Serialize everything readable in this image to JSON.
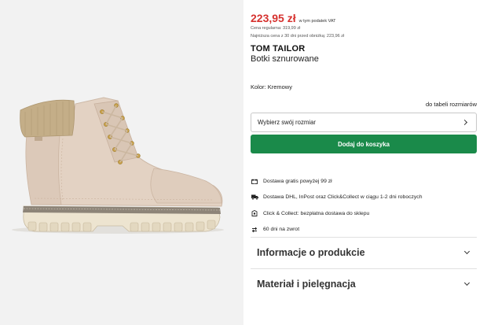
{
  "product": {
    "price": "223,95 zł",
    "vat_note": "w tym podatek VAT",
    "regular_price": "Cena regularna: 319,99 zł",
    "lowest_price": "Najniższa cena z 30 dni przed obniżką: 223,96 zł",
    "brand": "TOM TAILOR",
    "name": "Botki sznurowane",
    "color_label": "Kolor:",
    "color_value": "Kremowy",
    "size_table_link": "do tabeli rozmiarów",
    "size_select_label": "Wybierz swój rozmiar",
    "add_to_cart": "Dodaj do koszyka"
  },
  "colors": {
    "price": "#d6322f",
    "add_button": "#1a8a4a",
    "gallery_bg": "#f2f2f2"
  },
  "perks": [
    {
      "icon": "gift-icon",
      "text": "Dostawa gratis powyżej 99 zł"
    },
    {
      "icon": "truck-icon",
      "text": "Dostawa DHL, InPost oraz Click&Collect w ciągu 1-2 dni roboczych"
    },
    {
      "icon": "store-icon",
      "text": "Click & Collect: bezpłatna dostawa do sklepu"
    },
    {
      "icon": "return-arrows-icon",
      "text": "60 dni na zwrot"
    }
  ],
  "accordion": [
    {
      "title": "Informacje o produkcie"
    },
    {
      "title": "Materiał i pielęgnacja"
    }
  ],
  "image": {
    "subject": "boot-image"
  }
}
